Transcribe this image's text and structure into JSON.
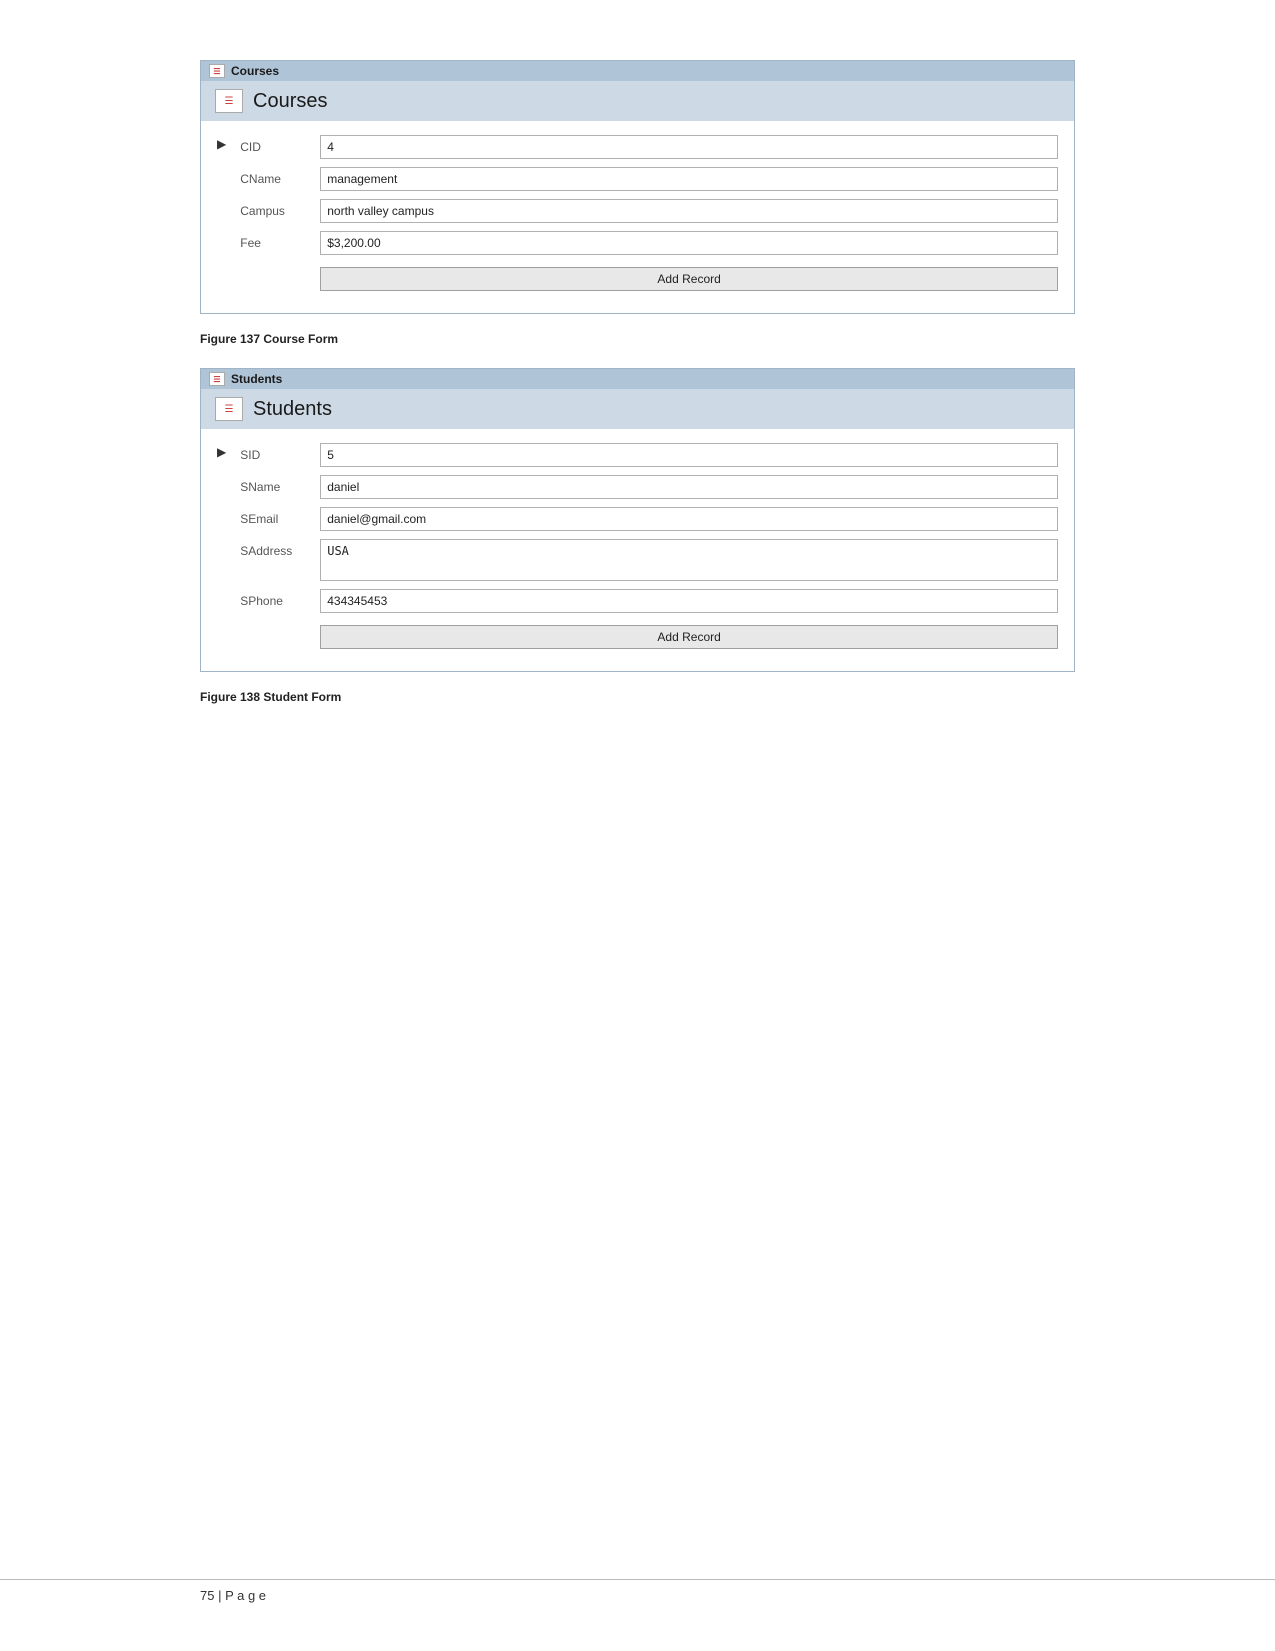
{
  "courses_form": {
    "title_bar_label": "Courses",
    "header_title": "Courses",
    "fields": [
      {
        "label": "CID",
        "value": "4",
        "multiline": false
      },
      {
        "label": "CName",
        "value": "management",
        "multiline": false
      },
      {
        "label": "Campus",
        "value": "north valley campus",
        "multiline": false
      },
      {
        "label": "Fee",
        "value": "$3,200.00",
        "multiline": false
      }
    ],
    "add_button_label": "Add Record"
  },
  "courses_caption": "Figure 137 Course Form",
  "students_form": {
    "title_bar_label": "Students",
    "header_title": "Students",
    "fields": [
      {
        "label": "SID",
        "value": "5",
        "multiline": false
      },
      {
        "label": "SName",
        "value": "daniel",
        "multiline": false
      },
      {
        "label": "SEmail",
        "value": "daniel@gmail.com",
        "multiline": false
      },
      {
        "label": "SAddress",
        "value": "USA",
        "multiline": true
      },
      {
        "label": "SPhone",
        "value": "434345453",
        "multiline": false
      }
    ],
    "add_button_label": "Add Record"
  },
  "students_caption": "Figure 138 Student Form",
  "footer": {
    "page_number": "75",
    "separator": " | ",
    "page_label": "P a g e"
  }
}
